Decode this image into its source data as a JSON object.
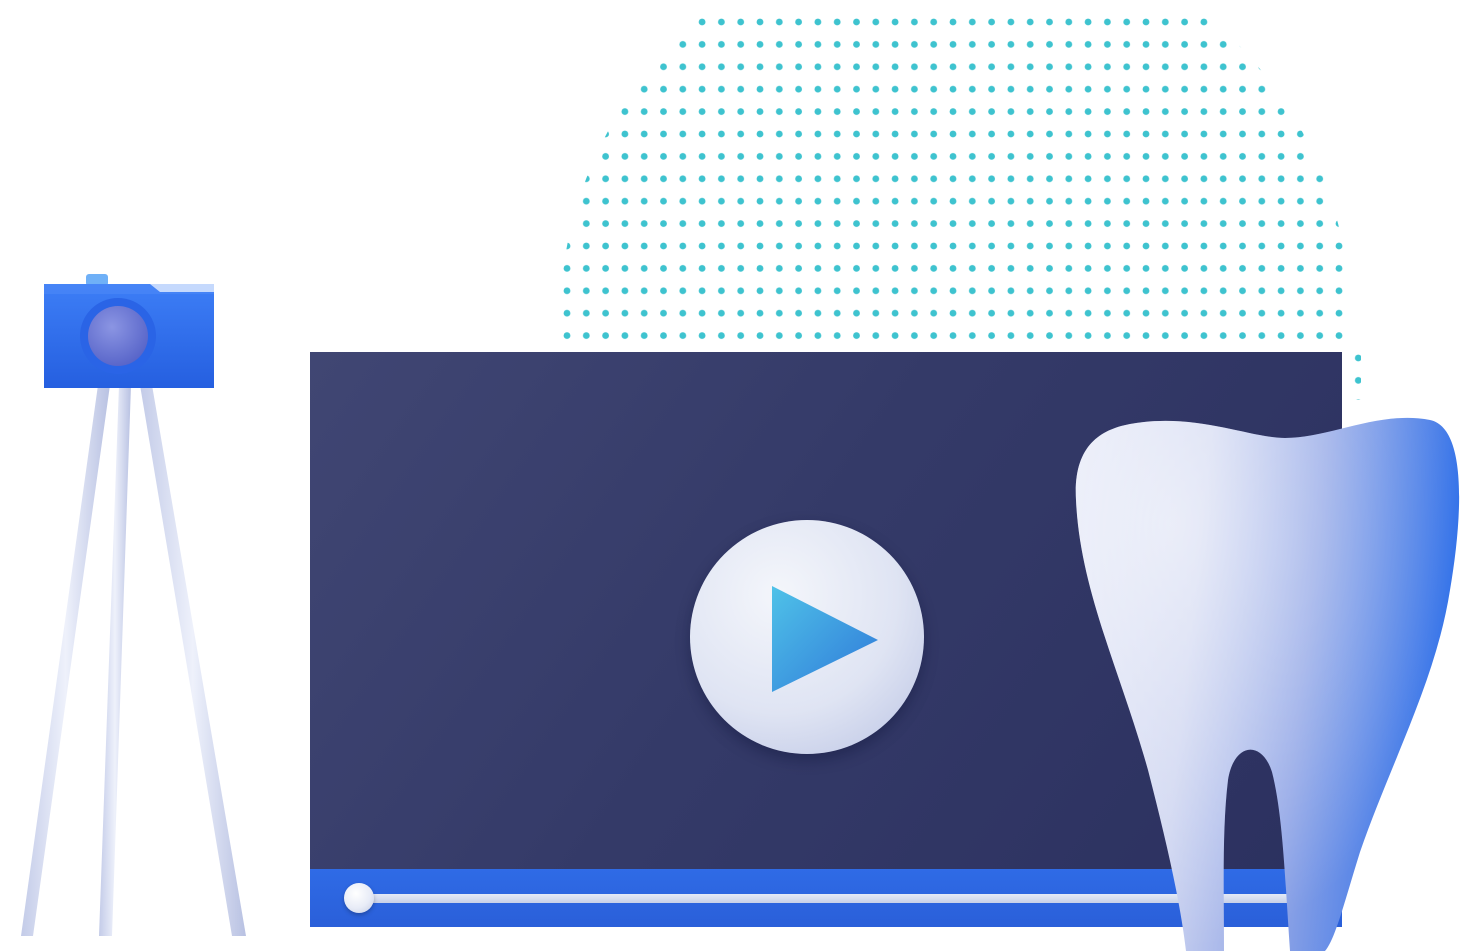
{
  "scene": {
    "subject": "dental-video-illustration",
    "background_color": "#ffffff",
    "dot_color": "#3ec3cf"
  },
  "video_player": {
    "screen_color": "#353b69",
    "control_bar_color": "#2d66e3",
    "progress": 0,
    "play_icon": "play-icon",
    "play_icon_color": "#3fa0e0"
  },
  "camera": {
    "icon": "camera-icon",
    "body_color": "#2f6ff0",
    "lens_color": "#6a78d8",
    "tripod_color": "#d6dcf2"
  },
  "tooth": {
    "icon": "tooth-icon",
    "color_light": "#dde2f5",
    "color_dark": "#2f6fe8"
  }
}
